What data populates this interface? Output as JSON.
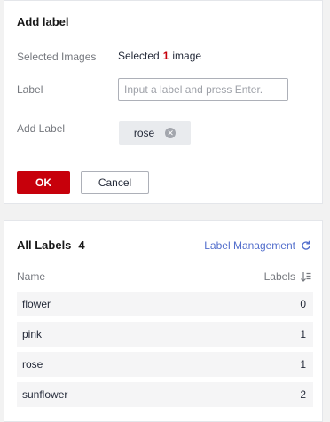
{
  "add_label": {
    "title": "Add label",
    "selected_images_label": "Selected Images",
    "selected_prefix": "Selected",
    "selected_count": "1",
    "selected_suffix": "image",
    "label_field_label": "Label",
    "label_input_value": "",
    "label_input_placeholder": "Input a label and press Enter.",
    "add_label_label": "Add Label",
    "tags": [
      "rose"
    ],
    "ok_label": "OK",
    "cancel_label": "Cancel"
  },
  "all_labels": {
    "title": "All Labels",
    "count": "4",
    "management_link": "Label Management",
    "columns": {
      "name": "Name",
      "labels": "Labels"
    },
    "rows": [
      {
        "name": "flower",
        "count": "0"
      },
      {
        "name": "pink",
        "count": "1"
      },
      {
        "name": "rose",
        "count": "1"
      },
      {
        "name": "sunflower",
        "count": "2"
      }
    ]
  },
  "icons": {
    "tag_close": "close-circle-icon",
    "refresh": "refresh-icon",
    "sort": "sort-icon"
  },
  "colors": {
    "primary_red": "#c7000b",
    "link_blue": "#526ecc"
  }
}
